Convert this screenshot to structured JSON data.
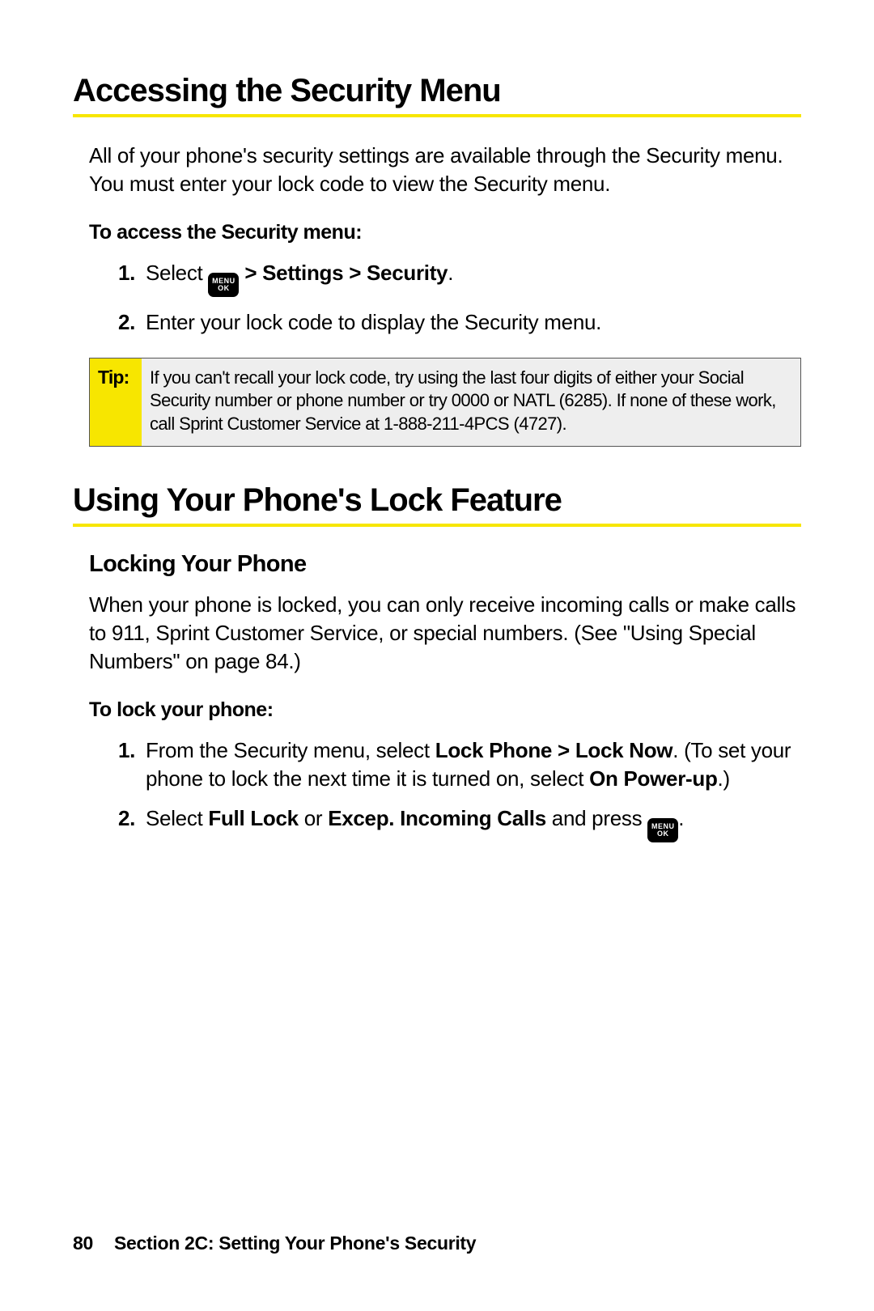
{
  "section1": {
    "heading": "Accessing the Security Menu",
    "intro": "All of your phone's security settings are available through the Security menu. You must enter your lock code to view the Security menu.",
    "lead": "To access the Security menu:",
    "step1_pre": "Select ",
    "step1_icon_top": "MENU",
    "step1_icon_bottom": "OK",
    "step1_bold": " > Settings > Security",
    "step1_post": ".",
    "step2": "Enter your lock code to display the Security menu.",
    "tip_label": "Tip:",
    "tip_body": "If you can't recall your lock code, try using the last four digits of either your Social Security number or phone number or try 0000 or NATL (6285). If none of these work, call Sprint Customer Service at 1-888-211-4PCS (4727)."
  },
  "section2": {
    "heading": "Using Your Phone's Lock Feature",
    "sub": "Locking Your Phone",
    "intro": "When your phone is locked, you can only receive incoming calls or make calls to 911, Sprint Customer Service, or special numbers. (See \"Using Special Numbers\" on page 84.)",
    "lead": "To lock your phone:",
    "s1_a": "From the Security menu, select ",
    "s1_b": "Lock Phone > Lock Now",
    "s1_c": ". (To set your phone to lock the next time it is turned on, select ",
    "s1_d": "On Power-up",
    "s1_e": ".)",
    "s2_a": "Select ",
    "s2_b": "Full Lock",
    "s2_c": " or ",
    "s2_d": "Excep. Incoming Calls",
    "s2_e": " and press ",
    "s2_icon_top": "MENU",
    "s2_icon_bottom": "OK",
    "s2_f": "."
  },
  "footer": {
    "page": "80",
    "section": "Section 2C: Setting Your Phone's Security"
  },
  "list_numbers": {
    "one": "1.",
    "two": "2."
  }
}
